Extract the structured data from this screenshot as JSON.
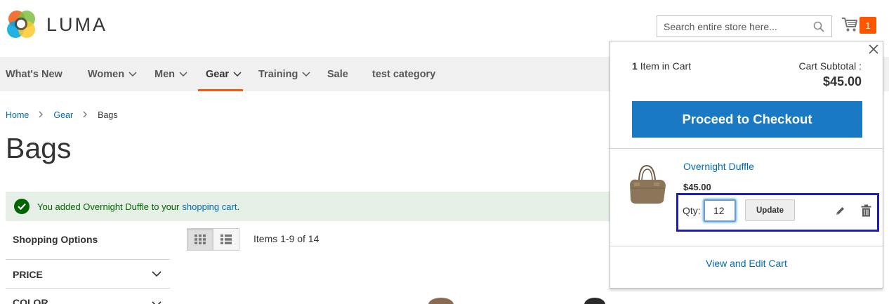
{
  "header": {
    "logo_text": "LUMA",
    "search_placeholder": "Search entire store here...",
    "cart_count": "1"
  },
  "nav": {
    "items": [
      {
        "label": "What's New",
        "has_dropdown": false
      },
      {
        "label": "Women",
        "has_dropdown": true
      },
      {
        "label": "Men",
        "has_dropdown": true
      },
      {
        "label": "Gear",
        "has_dropdown": true,
        "active": true
      },
      {
        "label": "Training",
        "has_dropdown": true
      },
      {
        "label": "Sale",
        "has_dropdown": false
      },
      {
        "label": "test category",
        "has_dropdown": false
      }
    ]
  },
  "breadcrumb": {
    "items": [
      "Home",
      "Gear",
      "Bags"
    ]
  },
  "page": {
    "title": "Bags"
  },
  "message": {
    "text_before": "You added Overnight Duffle to your",
    "link": "shopping cart",
    "text_after": "."
  },
  "sidebar": {
    "title": "Shopping Options",
    "filters": [
      "PRICE",
      "COLOR"
    ]
  },
  "toolbar": {
    "amount": "Items 1-9 of 14",
    "modes": [
      "grid",
      "list"
    ]
  },
  "minicart": {
    "count_number": "1",
    "count_label": "Item in Cart",
    "subtotal_label": "Cart Subtotal :",
    "subtotal_price": "$45.00",
    "checkout_label": "Proceed to Checkout",
    "item": {
      "name": "Overnight Duffle",
      "price": "$45.00",
      "qty_label": "Qty:",
      "qty_value": "12",
      "update_label": "Update"
    },
    "view_cart_label": "View and Edit Cart"
  },
  "colors": {
    "accent": "#ff5501",
    "primary_button": "#1979c3",
    "link": "#006bb4",
    "success_bg": "#e5efe5",
    "success_text": "#006400",
    "highlight_box": "#1b1bc8"
  }
}
